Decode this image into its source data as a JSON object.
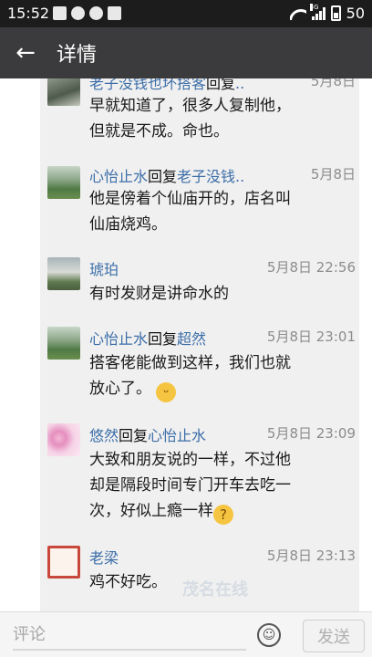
{
  "status_bar": {
    "time": "15:52",
    "battery": "50",
    "network": "3G"
  },
  "app_bar": {
    "back_icon": "←",
    "title": "详情"
  },
  "comments": [
    {
      "name": "老子没钱也坏搭客",
      "reply_word": "回复",
      "reply_to": "..",
      "time": "5月8日",
      "lines": [
        "早就知道了，很多人复制他，",
        "但就是不成。命也。"
      ]
    },
    {
      "name": "心怡止水",
      "reply_word": "回复",
      "reply_to": "老子没钱..",
      "time": "5月8日",
      "lines": [
        "他是傍着个仙庙开的，店名叫",
        "仙庙烧鸡。"
      ]
    },
    {
      "name": "琥珀",
      "time": "5月8日 22:56",
      "lines": [
        "有时发财是讲命水的"
      ]
    },
    {
      "name": "心怡止水",
      "reply_word": "回复",
      "reply_to": "超然",
      "time": "5月8日 23:01",
      "lines": [
        "搭客佬能做到这样，我们也就",
        "放心了。"
      ]
    },
    {
      "name": "悠然",
      "reply_word": "回复",
      "reply_to": "心怡止水",
      "time": "5月8日 23:09",
      "lines": [
        "大致和朋友说的一样，不过他",
        "却是隔段时间专门开车去吃一",
        "次，好似上瘾一样"
      ]
    },
    {
      "name": "老梁",
      "time": "5月8日 23:13",
      "lines": [
        "鸡不好吃。"
      ]
    }
  ],
  "watermark": "茂名在线",
  "input_bar": {
    "placeholder": "评论",
    "emoji_icon": "☺",
    "send_label": "发送"
  }
}
